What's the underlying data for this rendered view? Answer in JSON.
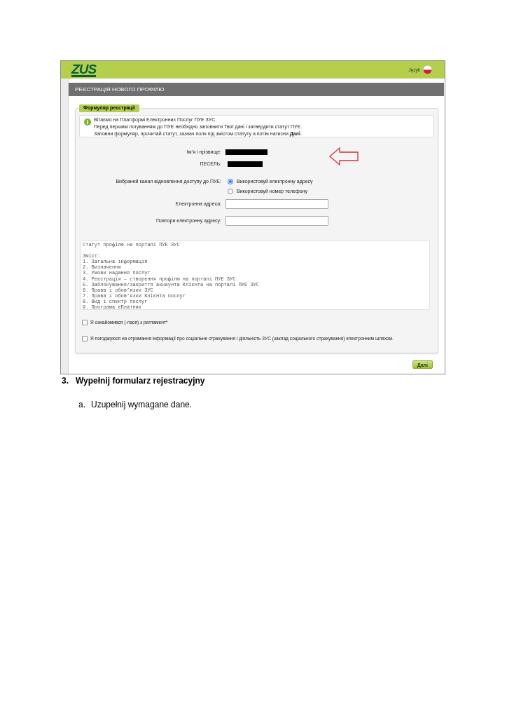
{
  "header": {
    "logo": "ZUS",
    "language_label": "Język"
  },
  "page_title": "РЕЄСТРАЦІЯ НОВОГО ПРОФІЛЮ",
  "form": {
    "legend": "Формуляр реєстрації",
    "info": {
      "lines": [
        "Вітаємо на Платформі Електронних Послуг ПУЕ ЗУС.",
        "Перед першим логуванням до ПУЕ необхідно заповнити Твої дані і затвердити статут ПУЕ.",
        "Заповни формуляр, прочитай статут, зазнач поля під змістом статуту а потім натисни **Далі**."
      ]
    },
    "personal": [
      {
        "label": "Ім’я і прізвище:",
        "redacted": true
      },
      {
        "label": "ПЕСЕЛЬ:",
        "redacted": true
      }
    ],
    "recovery_channel": {
      "label": "Вибраний канал відновлення доступу до ПУЕ:",
      "options": [
        {
          "label": "Використовуй електронну адресу",
          "selected": true
        },
        {
          "label": "Використовуй номер телефону",
          "selected": false
        }
      ]
    },
    "email_fields": [
      {
        "label": "Електронна адреса:"
      },
      {
        "label": "Повтори електронну адресу:"
      }
    ],
    "statute": {
      "title": "Статут профілю на порталі ПУЕ ЗУС",
      "contents_heading": "Зміст:",
      "items": [
        "1. Загальна інформація",
        "2. Визначення",
        "3. Умови надання послуг",
        "4. Реєстрація – створення профілю на порталі ПУЕ ЗУС",
        "5. Заблокування/закриття аккаунта Клієнта на порталі ПУЕ ЗУС",
        "6. Права і обов’язки ЗУС",
        "7. Права і обов’язки Клієнта послуг",
        "8. Вид і спектр послуг",
        "9. Програма еПлатник"
      ]
    },
    "consents": [
      {
        "label": "Я ознайомився (-лася) з регламент*",
        "checked": false
      },
      {
        "label": "Я погоджуюся на отримання інформації про соціальне страхування і діяльність ЗУС (заклад соціального страхування) електронним шляхом.",
        "checked": false
      }
    ],
    "next_button": "Далі"
  },
  "document": {
    "step_number": "3.",
    "step_title": "Wypełnij formularz rejestracyjny",
    "substeps": [
      {
        "marker": "a.",
        "text": "Uzupełnij wymagane dane."
      }
    ]
  }
}
